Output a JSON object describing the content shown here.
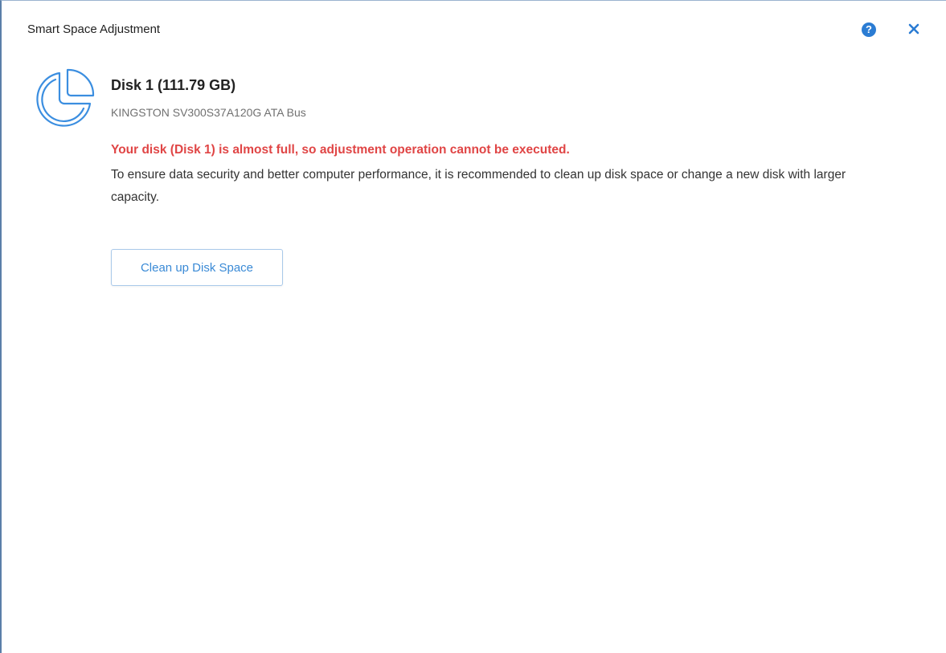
{
  "window": {
    "title": "Smart Space Adjustment",
    "help_icon": "question-circle-icon",
    "help_glyph": "?",
    "close_icon": "close-icon"
  },
  "disk": {
    "icon": "pie-chart-icon",
    "name": "Disk 1 (111.79 GB)",
    "model": "KINGSTON SV300S37A120G ATA Bus"
  },
  "message": {
    "warning": "Your disk (Disk 1) is almost full, so adjustment operation cannot be executed.",
    "description": "To ensure data security and better computer performance, it is recommended to clean up disk space or change a new disk with larger capacity."
  },
  "actions": {
    "cleanup_label": "Clean up Disk Space"
  },
  "colors": {
    "accent": "#2b7cd3",
    "warning": "#e04545",
    "button_text": "#3a8ad6",
    "button_border": "#a9c9ea"
  }
}
